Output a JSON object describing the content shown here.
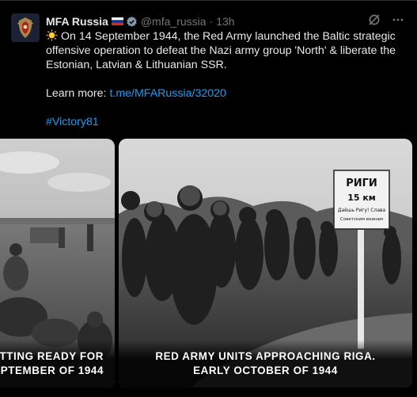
{
  "author": {
    "name": "MFA Russia",
    "handle": "@mfa_russia",
    "separator": "·",
    "time": "13h"
  },
  "tweet": {
    "text_line": "On 14 September 1944, the Red Army launched the Baltic strategic offensive operation to defeat the Nazi army group 'North' & liberate the Estonian, Latvian & Lithuanian SSR.",
    "learn_more_label": "Learn more:",
    "learn_more_link": "t.me/MFARussia/32020",
    "hashtag": "#Victory81"
  },
  "media": {
    "left_caption_line1": "TTING READY FOR",
    "left_caption_line2": "PTEMBER OF 1944",
    "right_caption_line1": "RED ARMY UNITS APPROACHING RIGA.",
    "right_caption_line2": "EARLY OCTOBER OF 1944",
    "sign_line1": "РИГИ",
    "sign_line2": "15 км",
    "sign_line3": "Даёшь Ригу! Слава",
    "sign_line4": "Советским воинам"
  },
  "icons": {
    "avatar": "coat-of-arms-icon",
    "flag": "russia-flag-icon",
    "verified": "verified-badge-icon",
    "grok": "grok-icon",
    "more": "more-icon",
    "emoji": "sun-emoji-icon"
  },
  "colors": {
    "background": "#000000",
    "text": "#e7e9ea",
    "secondary": "#71767b",
    "link": "#1d9bf0"
  }
}
